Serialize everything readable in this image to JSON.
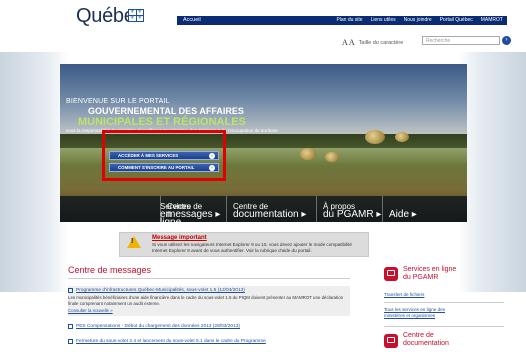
{
  "header": {
    "logo_text": "Québec",
    "flag_icon": "fleur-de-lis-flag-icon",
    "accueil": "Accueil",
    "links": [
      "Plan du site",
      "Liens utiles",
      "Nous joindre",
      "Portail Québec",
      "MAMROT"
    ]
  },
  "tools": {
    "aa_label": "A A",
    "text_size_label": "Taille du caractère",
    "search_placeholder": "Recherche",
    "search_icon": "search-go-icon"
  },
  "hero": {
    "welcome": "BIENVENUE SUR LE PORTAIL",
    "gov": "GOUVERNEMENTAL DES AFFAIRES",
    "municipal": "MUNICIPALES ET RÉGIONALES",
    "subtitle": "sous la responsabilité du ministère des Affaires municipales, des Régions et de l'Occupation du territoire",
    "buttons": [
      "ACCÉDER À MES SERVICES",
      "COMMENT S'INSCRIRE AU PORTAIL"
    ]
  },
  "nav": [
    {
      "line1": "Services",
      "line2": "en ligne ▸"
    },
    {
      "line1": "Centre de",
      "line2": "messages ▸"
    },
    {
      "line1": "Centre de",
      "line2": "documentation ▸"
    },
    {
      "line1": "À propos",
      "line2": "du PGAMR ▸"
    },
    {
      "line1": "",
      "line2": "Aide ▸"
    }
  ],
  "notice": {
    "title": "Message important",
    "text": "Si vous utilisez les navigateurs Internet Explorer 9 ou 10, vous devez ajouter le mode compatibilité Internet Explorer 8 avant de vous authentifier. Voir la rubrique d'aide du portail."
  },
  "messages": {
    "title": "Centre de messages",
    "items": [
      {
        "head": "Programme d'infrastructures Québec-Municipalités, sous-volet 1.5 (12/04/2013)",
        "body": "Les municipalités bénéficiaires d'une aide financière dans le cadre du sous-volet 1.5 du PIQM doivent présenter au MAMROT une déclaration finale comprenant notamment un audit externe.",
        "more": "Consulter la nouvelle »"
      },
      {
        "head": "PES Compensations - Début du chargement des données 2013 (28/03/2013)"
      },
      {
        "head": "Fermeture du sous-volet 2.4 et lancement du sous-volet 5.1 dans le cadre du Programme"
      }
    ]
  },
  "right": {
    "services_title1": "Services en ligne",
    "services_title2": "du PGAMR",
    "transfer": "Transfert de fichiers",
    "all_services": "Tous les services en ligne des ministères et organismes",
    "doc_title1": "Centre de",
    "doc_title2": "documentation"
  }
}
